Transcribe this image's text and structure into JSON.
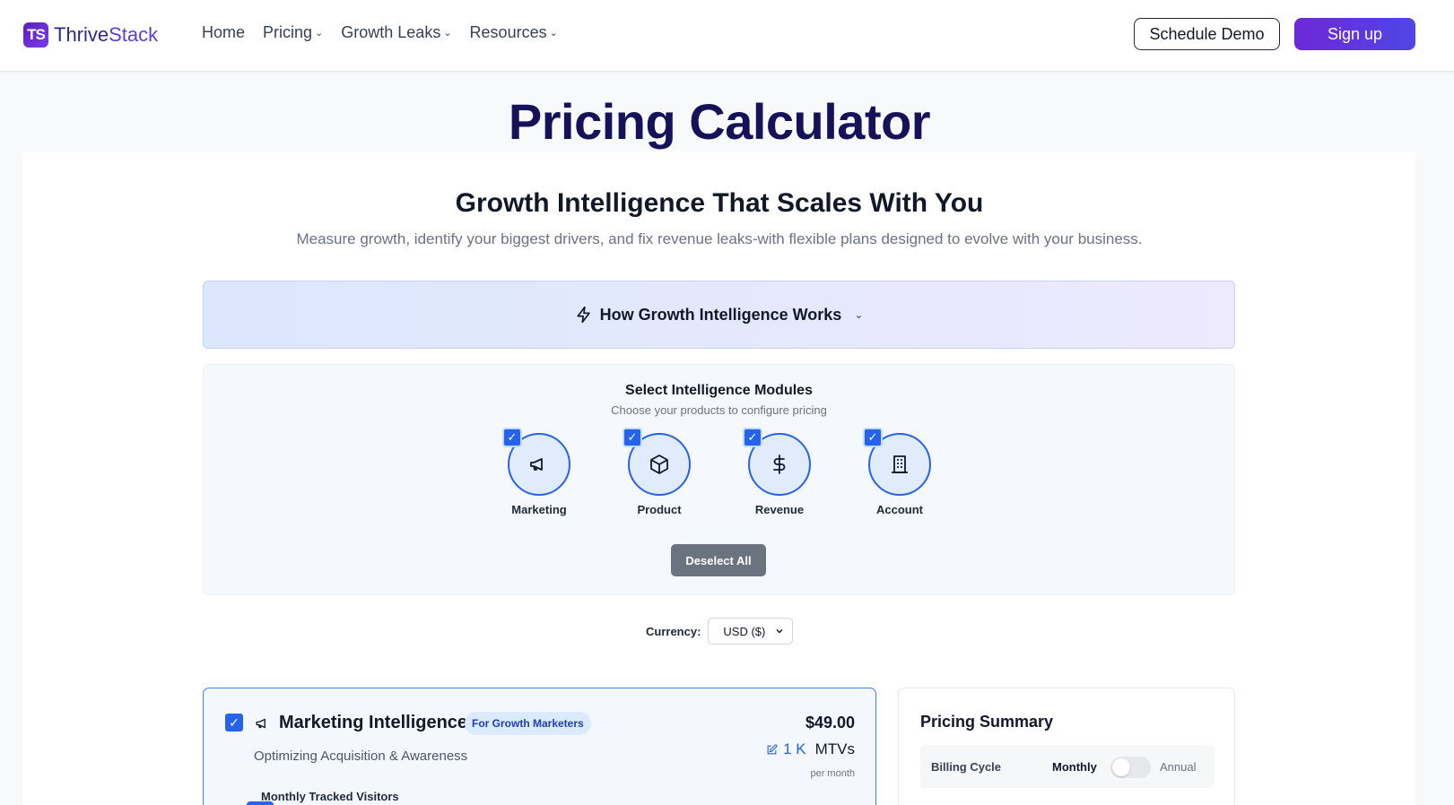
{
  "header": {
    "logo_mark": "TS",
    "logo_text_1": "Thrive",
    "logo_text_2": "Stack",
    "nav": [
      {
        "label": "Home",
        "has_dropdown": false
      },
      {
        "label": "Pricing",
        "has_dropdown": true
      },
      {
        "label": "Growth Leaks",
        "has_dropdown": true
      },
      {
        "label": "Resources",
        "has_dropdown": true
      }
    ],
    "schedule_demo": "Schedule Demo",
    "sign_up": "Sign up"
  },
  "main": {
    "title": "Pricing Calculator",
    "subtitle": "Growth Intelligence That Scales With You",
    "tagline": "Measure growth, identify your biggest drivers, and fix revenue leaks-with flexible plans designed to evolve with your business.",
    "how_it_works": "How Growth Intelligence Works"
  },
  "modules": {
    "title": "Select Intelligence Modules",
    "subtitle": "Choose your products to configure pricing",
    "items": [
      {
        "label": "Marketing",
        "icon": "megaphone-icon",
        "checked": true
      },
      {
        "label": "Product",
        "icon": "box-icon",
        "checked": true
      },
      {
        "label": "Revenue",
        "icon": "dollar-icon",
        "checked": true
      },
      {
        "label": "Account",
        "icon": "building-icon",
        "checked": true
      }
    ],
    "deselect_all": "Deselect All"
  },
  "currency": {
    "label": "Currency:",
    "selected": "USD ($)"
  },
  "marketing_card": {
    "checked": true,
    "title": "Marketing Intelligence",
    "badge": "For Growth Marketers",
    "description": "Optimizing Acquisition & Awareness",
    "price": "$49.00",
    "mtv_value": "1 K",
    "mtv_unit": "MTVs",
    "per": "per month",
    "visitors_label": "Monthly Tracked Visitors"
  },
  "summary": {
    "title": "Pricing Summary",
    "billing_label": "Billing Cycle",
    "monthly": "Monthly",
    "annual": "Annual",
    "annual_selected": false
  },
  "colors": {
    "brand": "#5b21b6",
    "accent": "#2563eb",
    "title": "#15125a"
  }
}
